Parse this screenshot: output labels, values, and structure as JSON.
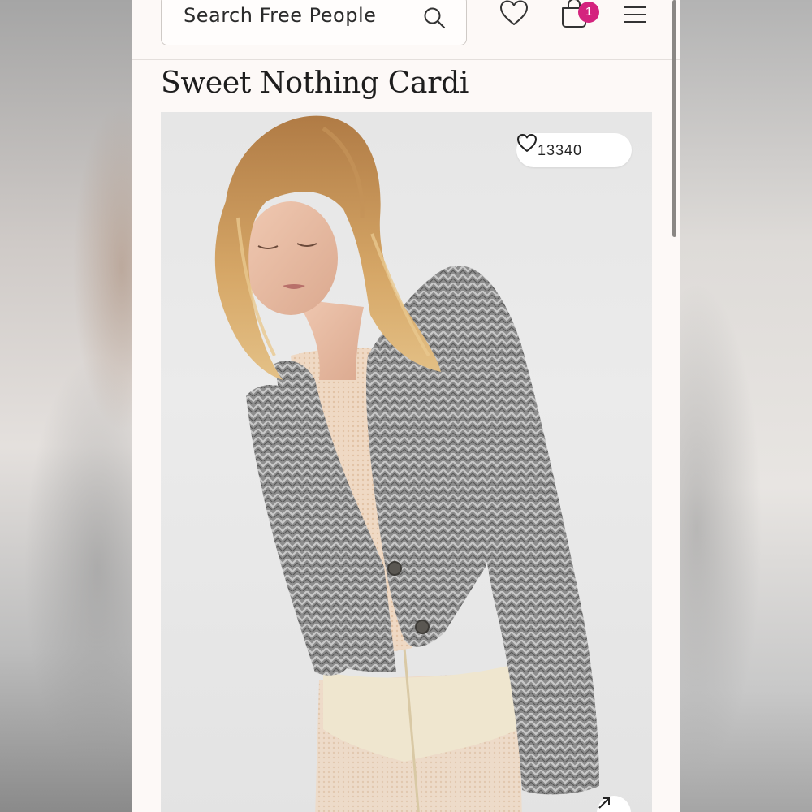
{
  "header": {
    "search_placeholder": "Search Free People",
    "cart_count": "1",
    "icons": {
      "search": "search-icon",
      "wishlist": "heart-outline-icon",
      "cart": "shopping-bag-icon",
      "menu": "hamburger-menu-icon"
    }
  },
  "product": {
    "title": "Sweet Nothing Cardi",
    "likes": "13340",
    "image_alt_icons": {
      "like": "heart-outline-icon",
      "expand": "expand-arrow-icon"
    }
  },
  "colors": {
    "badge": "#d4237e",
    "page_bg": "#fdf9f7",
    "text": "#1d1d1d"
  }
}
